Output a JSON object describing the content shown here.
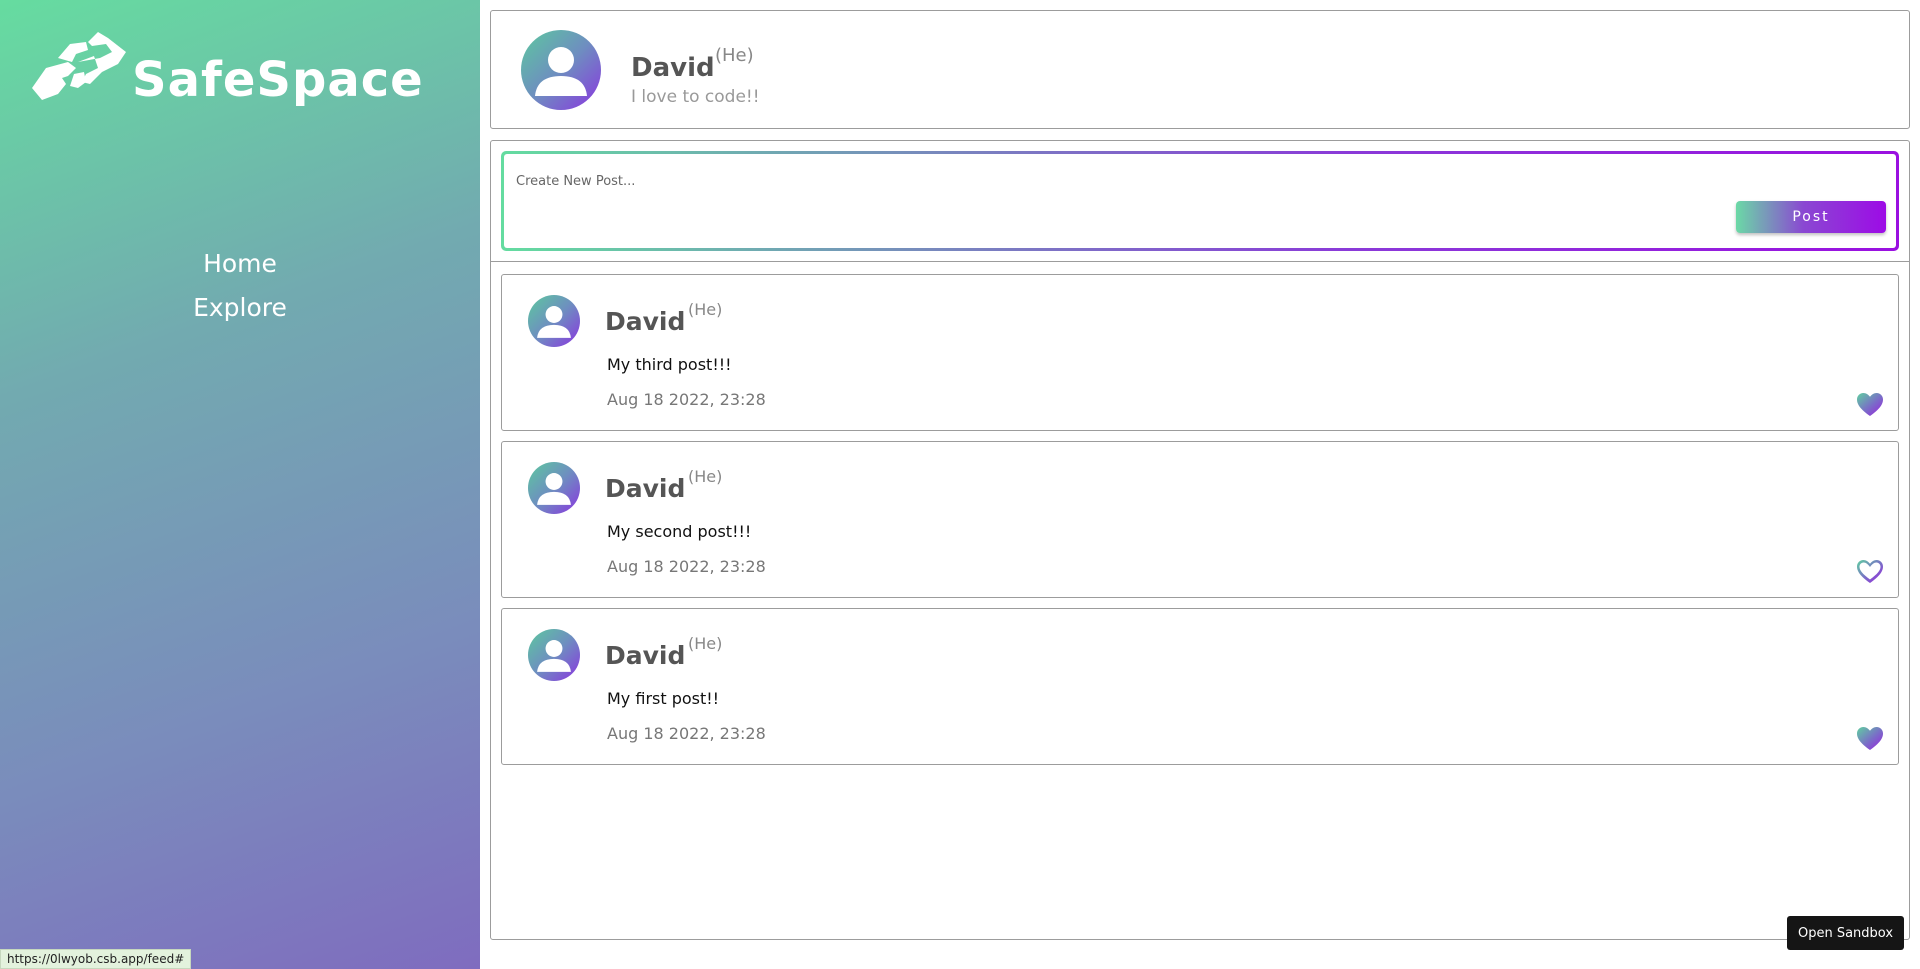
{
  "sidebar": {
    "brand": "SafeSpace",
    "nav": [
      {
        "label": "Home"
      },
      {
        "label": "Explore"
      }
    ]
  },
  "profile": {
    "name": "David",
    "pronoun": "(He)",
    "bio": "I love to code!!"
  },
  "composer": {
    "placeholder": "Create New Post...",
    "post_label": "Post"
  },
  "posts": [
    {
      "author": "David",
      "pronoun": "(He)",
      "text": "My third post!!!",
      "date": "Aug 18 2022, 23:28",
      "liked": true
    },
    {
      "author": "David",
      "pronoun": "(He)",
      "text": "My second post!!!",
      "date": "Aug 18 2022, 23:28",
      "liked": false
    },
    {
      "author": "David",
      "pronoun": "(He)",
      "text": "My first post!!",
      "date": "Aug 18 2022, 23:28",
      "liked": true
    }
  ],
  "status_bar": {
    "url": "https://0lwyob.csb.app/feed#"
  },
  "sandbox_button": "Open Sandbox",
  "icons": {
    "logo": "hands-logo-icon",
    "avatar": "user-avatar-icon",
    "like_filled": "heart-filled-icon",
    "like_outline": "heart-outline-icon"
  },
  "colors": {
    "gradient_start": "#64dca0",
    "gradient_end": "#9a10e0",
    "text_dark": "#555555",
    "text_muted": "#888888"
  }
}
